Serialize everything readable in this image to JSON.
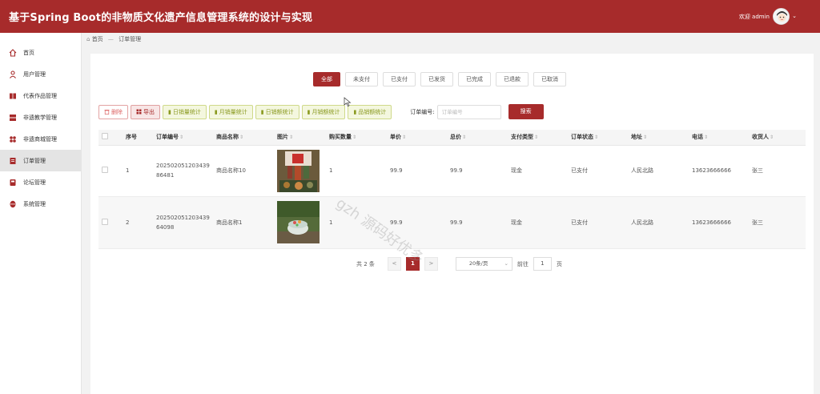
{
  "header": {
    "title": "基于Spring Boot的非物质文化遗产信息管理系统的设计与实现",
    "welcome": "欢迎 admin"
  },
  "sidebar": {
    "items": [
      {
        "label": "首页",
        "icon": "home-icon"
      },
      {
        "label": "用户管理",
        "icon": "user-icon"
      },
      {
        "label": "代表作品管理",
        "icon": "book-icon"
      },
      {
        "label": "非遗教学管理",
        "icon": "teach-icon"
      },
      {
        "label": "非遗商城管理",
        "icon": "grid-icon"
      },
      {
        "label": "订单管理",
        "icon": "order-icon",
        "active": true
      },
      {
        "label": "论坛管理",
        "icon": "forum-icon"
      },
      {
        "label": "系统管理",
        "icon": "system-icon"
      }
    ]
  },
  "breadcrumb": {
    "home": "首页",
    "separator": "—",
    "current": "订单管理"
  },
  "tabs": [
    "全部",
    "未支付",
    "已支付",
    "已发货",
    "已完成",
    "已退款",
    "已取消"
  ],
  "toolbar": {
    "delete": "删除",
    "export": "导出",
    "stats": [
      "日销量统计",
      "月销量统计",
      "日销额统计",
      "月销额统计",
      "品销额统计"
    ],
    "search_label": "订单编号:",
    "search_placeholder": "订单编号",
    "search_button": "搜索"
  },
  "table": {
    "columns": [
      "序号",
      "订单编号",
      "商品名称",
      "图片",
      "购买数量",
      "单价",
      "总价",
      "支付类型",
      "订单状态",
      "地址",
      "电话",
      "收货人"
    ],
    "rows": [
      {
        "index": "1",
        "order_no": "20250205120343986481",
        "product": "商品名称10",
        "qty": "1",
        "price": "99.9",
        "total": "99.9",
        "pay_type": "现金",
        "status": "已支付",
        "address": "人民北路",
        "phone": "13623666666",
        "receiver": "张三"
      },
      {
        "index": "2",
        "order_no": "20250205120343964098",
        "product": "商品名称1",
        "qty": "1",
        "price": "99.9",
        "total": "99.9",
        "pay_type": "现金",
        "status": "已支付",
        "address": "人民北路",
        "phone": "13623666666",
        "receiver": "张三"
      }
    ]
  },
  "pager": {
    "total": "共 2 条",
    "prev": "<",
    "current": "1",
    "next": ">",
    "page_size": "20条/页",
    "goto": "前往",
    "goto_value": "1",
    "page_unit": "页"
  },
  "watermark": "gzh 源码好优多",
  "colors": {
    "primary": "#a72b2b"
  }
}
